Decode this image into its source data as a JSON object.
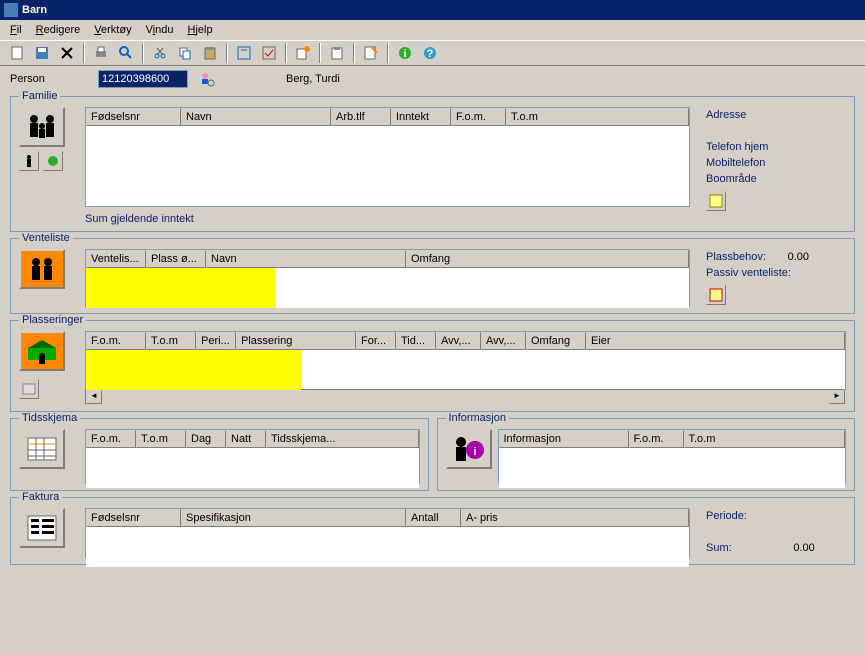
{
  "title": "Barn",
  "menu": {
    "fil": "Fil",
    "redigere": "Redigere",
    "verktoy": "Verktøy",
    "vindu": "Vindu",
    "hjelp": "Hjelp"
  },
  "person": {
    "label": "Person",
    "id": "12120398600",
    "name": "Berg, Turdi"
  },
  "familie": {
    "legend": "Familie",
    "cols": {
      "fodselsnr": "Fødselsnr",
      "navn": "Navn",
      "arbtlf": "Arb.tlf",
      "inntekt": "Inntekt",
      "fom": "F.o.m.",
      "tom": "T.o.m"
    },
    "side": {
      "adresse": "Adresse",
      "telefon": "Telefon hjem",
      "mobil": "Mobiltelefon",
      "boomrade": "Boområde"
    },
    "sum": "Sum gjeldende inntekt"
  },
  "venteliste": {
    "legend": "Venteliste",
    "cols": {
      "ventelis": "Ventelis...",
      "plass": "Plass ø...",
      "navn": "Navn",
      "omfang": "Omfang"
    },
    "side": {
      "plassbehov": "Plassbehov:",
      "plassbehov_val": "0.00",
      "passiv": "Passiv venteliste:"
    }
  },
  "plasseringer": {
    "legend": "Plasseringer",
    "cols": {
      "fom": "F.o.m.",
      "tom": "T.o.m",
      "peri": "Peri...",
      "plassering": "Plassering",
      "for": "For...",
      "tid": "Tid...",
      "avv1": "Avv,...",
      "avv2": "Avv,...",
      "omfang": "Omfang",
      "eier": "Eier"
    }
  },
  "tidsskjema": {
    "legend": "Tidsskjema",
    "cols": {
      "fom": "F.o.m.",
      "tom": "T.o.m",
      "dag": "Dag",
      "natt": "Natt",
      "tidsskjema": "Tidsskjema..."
    }
  },
  "informasjon": {
    "legend": "Informasjon",
    "cols": {
      "info": "Informasjon",
      "fom": "F.o.m.",
      "tom": "T.o.m"
    }
  },
  "faktura": {
    "legend": "Faktura",
    "cols": {
      "fodselsnr": "Fødselsnr",
      "spes": "Spesifikasjon",
      "antall": "Antall",
      "apris": "A- pris"
    },
    "side": {
      "periode": "Periode:",
      "sum": "Sum:",
      "sum_val": "0.00"
    }
  }
}
